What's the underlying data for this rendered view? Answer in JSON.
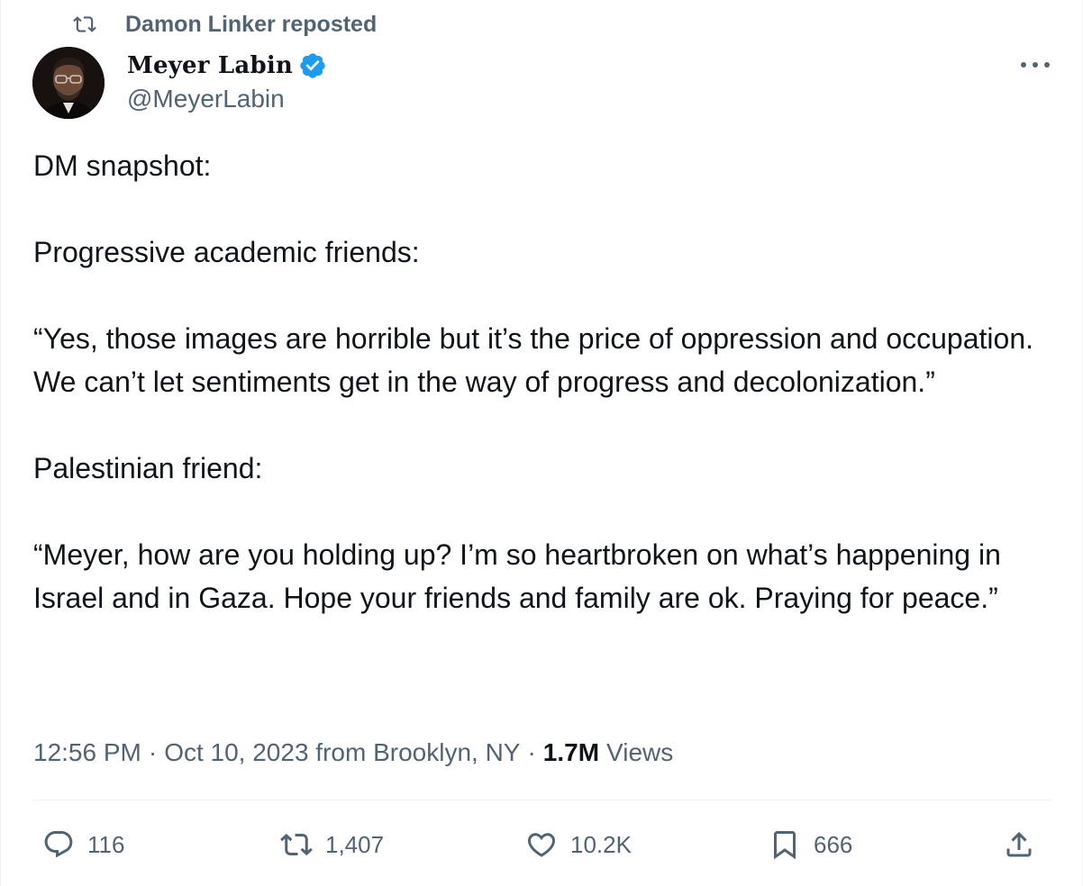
{
  "repost": {
    "label": "Damon Linker reposted",
    "icon": "repost-icon"
  },
  "author": {
    "name": "Meyer Labin",
    "handle": "@MeyerLabin",
    "verified": true,
    "verified_color": "#1d9bf0"
  },
  "tweet": {
    "paragraphs": [
      "DM snapshot:",
      "Progressive academic friends:",
      "“Yes, those images are horrible but it’s the price of oppression and occupation. We can’t let sentiments get in the way of progress and decolonization.”",
      "Palestinian friend:",
      "“Meyer, how are you holding up? I’m so heartbroken on what’s happening in Israel and in Gaza. Hope your friends and family are ok. Praying for peace.”"
    ]
  },
  "meta": {
    "time": "12:56 PM",
    "date": "Oct 10, 2023 from Brooklyn, NY",
    "separator": "·",
    "views_count": "1.7M",
    "views_label": "Views"
  },
  "actions": {
    "replies": "116",
    "reposts": "1,407",
    "likes": "10.2K",
    "bookmarks": "666"
  },
  "colors": {
    "text_primary": "#0f1419",
    "text_secondary": "#536471",
    "divider": "#eff3f4",
    "accent": "#1d9bf0"
  }
}
